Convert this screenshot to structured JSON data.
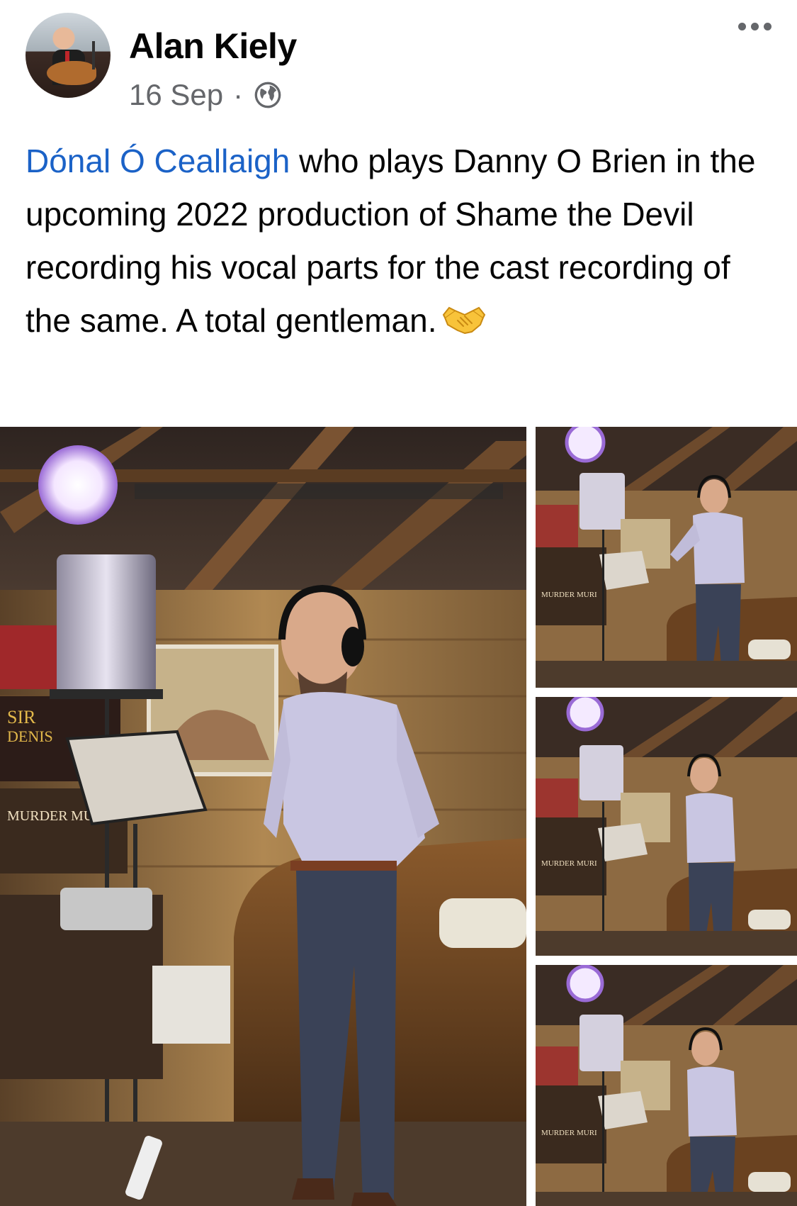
{
  "post": {
    "author": "Alan Kiely",
    "date": "16 Sep",
    "separator": "·",
    "audience_icon": "globe-icon",
    "more_icon": "more-options-icon",
    "mention": "Dónal Ó Ceallaigh",
    "body_text": " who plays Danny O Brien in the upcoming 2022 production of Shame the Devil recording his vocal parts for the cast recording of the same. A total gentleman.",
    "emoji": "handshake-emoji"
  },
  "photos": {
    "count": 4,
    "sign_text_main": [
      "SIR",
      "DENIS",
      "MURDER",
      "MURI"
    ],
    "sign_text_small": [
      "MURDER",
      "MURI"
    ]
  },
  "colors": {
    "link": "#1b62c7",
    "meta": "#65676b",
    "text": "#050505"
  }
}
